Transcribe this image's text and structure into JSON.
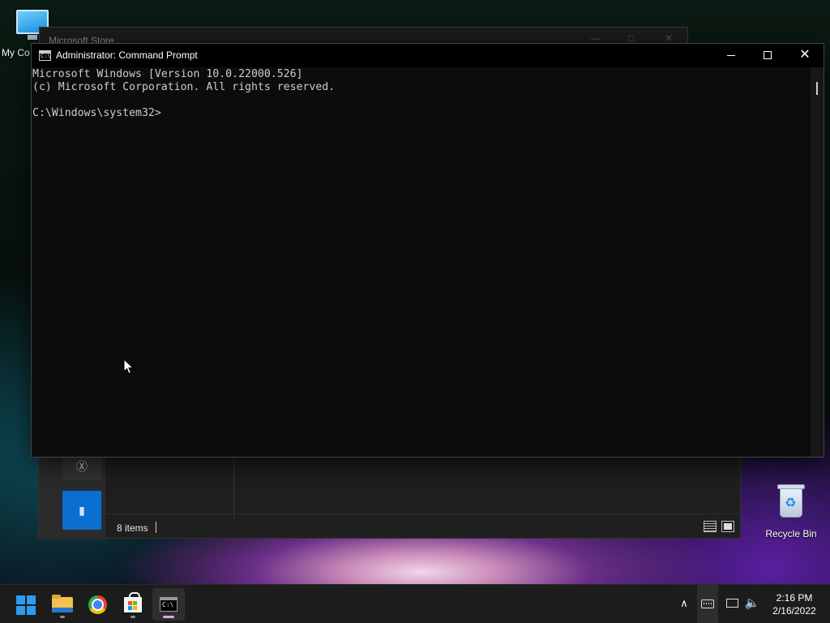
{
  "desktop": {
    "icons": [
      {
        "label": "My Co",
        "icon": "monitor-icon"
      },
      {
        "label": "Recycle Bin",
        "icon": "recycle-bin-icon"
      }
    ]
  },
  "store_window": {
    "title": "Microsoft Store"
  },
  "explorer_window": {
    "status": "8 items",
    "nav_tiles": [
      "xbox-icon",
      "app-tile-icon"
    ]
  },
  "cmd_window": {
    "title": "Administrator: Command Prompt",
    "lines": [
      "Microsoft Windows [Version 10.0.22000.526]",
      "(c) Microsoft Corporation. All rights reserved.",
      "",
      "C:\\Windows\\system32>"
    ],
    "controls": {
      "minimize": "minimize-icon",
      "maximize": "maximize-icon",
      "close": "✕"
    }
  },
  "taskbar": {
    "apps": [
      {
        "name": "Start",
        "icon": "windows-logo-icon"
      },
      {
        "name": "File Explorer",
        "icon": "folder-icon"
      },
      {
        "name": "Google Chrome",
        "icon": "chrome-icon"
      },
      {
        "name": "Microsoft Store",
        "icon": "store-bag-icon"
      },
      {
        "name": "Command Prompt",
        "icon": "terminal-icon",
        "active": true
      }
    ],
    "tray": {
      "chevron": "∧",
      "volume": "🔈",
      "time": "2:16 PM",
      "date": "2/16/2022"
    }
  },
  "colors": {
    "terminal_bg": "#0c0c0c",
    "terminal_text": "#cccccc",
    "taskbar_bg": "#1c1c1c",
    "accent": "#2c9bf0"
  }
}
